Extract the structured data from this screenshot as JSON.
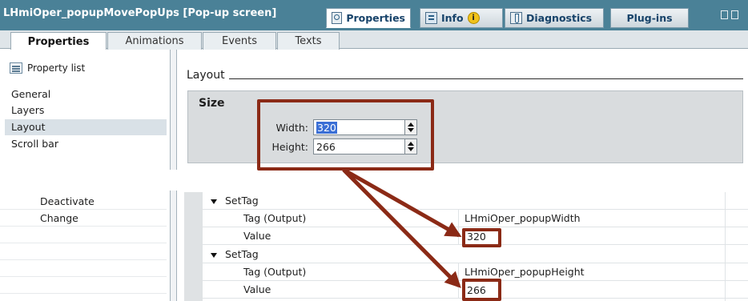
{
  "header": {
    "title": "LHmiOper_popupMovePopUps [Pop-up screen]",
    "tabs": [
      {
        "label": "Properties",
        "icon": "properties-icon",
        "active": true
      },
      {
        "label": "Info",
        "icon": "info-icon",
        "badge": "i",
        "active": false
      },
      {
        "label": "Diagnostics",
        "icon": "diagnostics-icon",
        "active": false
      },
      {
        "label": "Plug-ins",
        "active": false
      }
    ]
  },
  "subtabs": [
    {
      "label": "Properties",
      "active": true
    },
    {
      "label": "Animations",
      "active": false
    },
    {
      "label": "Events",
      "active": false
    },
    {
      "label": "Texts",
      "active": false
    }
  ],
  "sidebar": {
    "property_list_label": "Property list",
    "items": [
      {
        "label": "General",
        "active": false
      },
      {
        "label": "Layers",
        "active": false
      },
      {
        "label": "Layout",
        "active": true
      },
      {
        "label": "Scroll bar",
        "active": false
      }
    ]
  },
  "layout": {
    "section_title": "Layout",
    "size_group": "Size",
    "width_label": "Width:",
    "width_value": "320",
    "height_label": "Height:",
    "height_value": "266"
  },
  "events": {
    "items": [
      "Deactivate",
      "Change"
    ],
    "rows": [
      {
        "kind": "function",
        "name": "SetTag"
      },
      {
        "kind": "param",
        "name": "Tag (Output)",
        "value": "LHmiOper_popupWidth"
      },
      {
        "kind": "param",
        "name": "Value",
        "value": "320"
      },
      {
        "kind": "function",
        "name": "SetTag"
      },
      {
        "kind": "param",
        "name": "Tag (Output)",
        "value": "LHmiOper_popupHeight"
      },
      {
        "kind": "param",
        "name": "Value",
        "value": "266"
      }
    ]
  },
  "colors": {
    "title_bar": "#4a8197",
    "annotation": "#8b2a16",
    "selection": "#3b6fd5"
  }
}
